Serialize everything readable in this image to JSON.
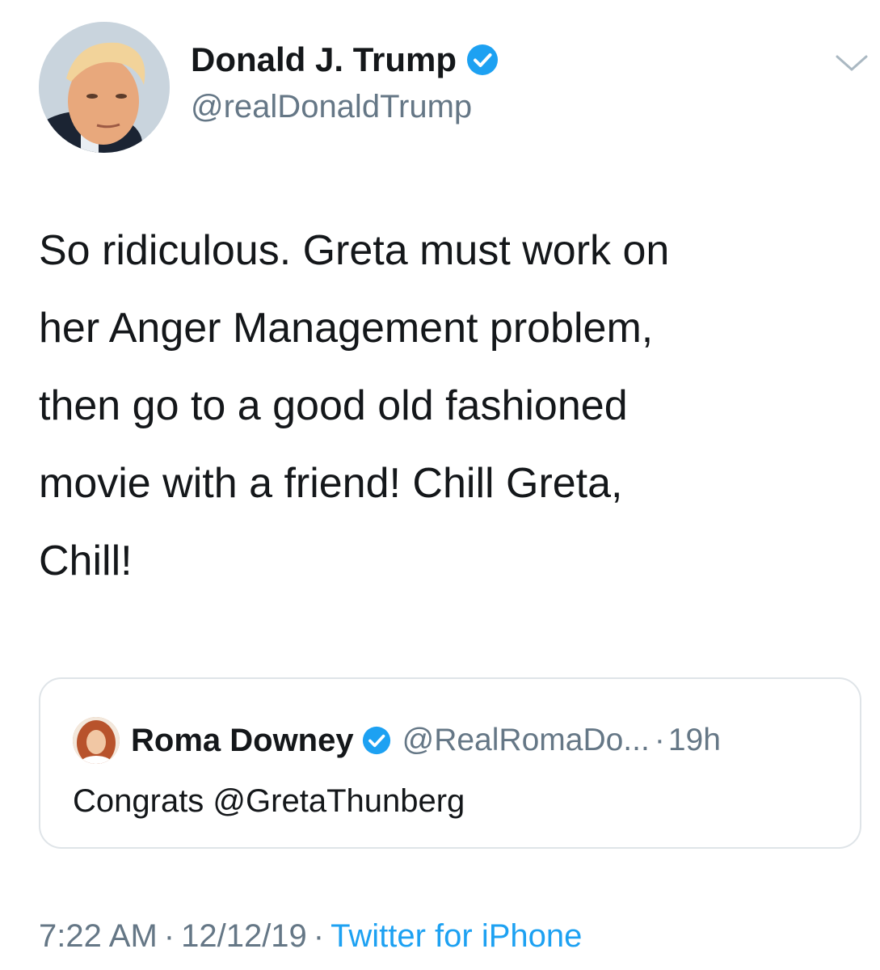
{
  "author": {
    "display_name": "Donald J. Trump",
    "handle": "@realDonaldTrump",
    "verified": true
  },
  "tweet": {
    "text": "So ridiculous. Greta must work on\nher Anger Management problem,\nthen go to a good old fashioned\nmovie with a friend! Chill Greta,\nChill!"
  },
  "quoted_tweet": {
    "display_name": "Roma Downey",
    "handle": "@RealRomaDo...",
    "separator": "·",
    "time": "19h",
    "text": "Congrats @GretaThunberg",
    "verified": true
  },
  "footer": {
    "time": "7:22 AM",
    "separator": "·",
    "date": "12/12/19",
    "source": "Twitter for iPhone"
  },
  "colors": {
    "accent": "#1da1f2",
    "text": "#14171a",
    "secondary_text": "#657786",
    "border": "#dfe4e8"
  },
  "icons": {
    "verified": "verified-badge-icon",
    "menu": "chevron-down-icon"
  }
}
